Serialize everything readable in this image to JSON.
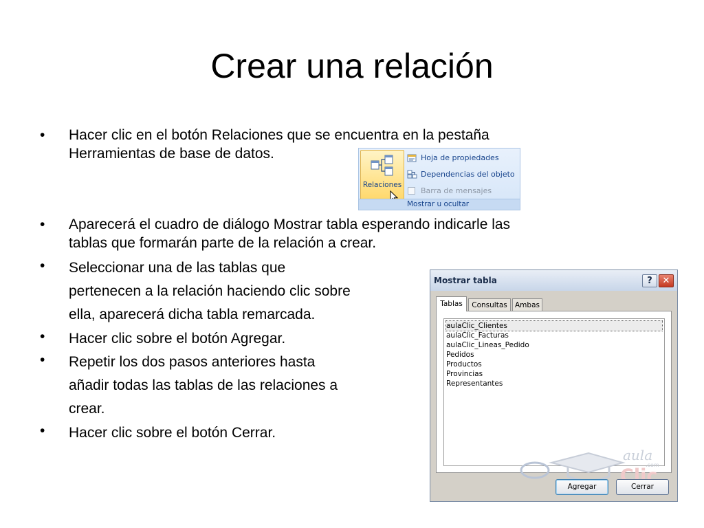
{
  "slide": {
    "title": "Crear una relación"
  },
  "bullets": [
    {
      "symbol": "•",
      "lines": [
        "Hacer clic en el botón Relaciones que se encuentra en la pestaña",
        "Herramientas de base de datos."
      ]
    },
    {
      "symbol": "•",
      "lines": [
        "Aparecerá el cuadro de diálogo Mostrar tabla esperando indicarle las",
        "tablas que formarán parte de la relación a crear."
      ]
    },
    {
      "symbol": "•",
      "lines": [
        "Seleccionar una de las tablas que",
        "pertenecen a la relación haciendo clic sobre",
        "ella, aparecerá dicha tabla remarcada."
      ]
    },
    {
      "symbol": "•",
      "lines": [
        "Hacer clic sobre el botón Agregar."
      ]
    },
    {
      "symbol": "•",
      "lines": [
        "Repetir los dos pasos anteriores hasta",
        "añadir todas las tablas de las relaciones a",
        "crear."
      ]
    },
    {
      "symbol": "•",
      "lines": [
        "Hacer clic sobre el botón Cerrar."
      ]
    }
  ],
  "ribbon": {
    "relaciones_label": "Relaciones",
    "items": [
      "Hoja de propiedades",
      "Dependencias del objeto",
      "Barra de mensajes"
    ],
    "group_label": "Mostrar u ocultar"
  },
  "dialog": {
    "title": "Mostrar tabla",
    "help_label": "?",
    "close_label": "✕",
    "tabs": [
      "Tablas",
      "Consultas",
      "Ambas"
    ],
    "tables": [
      "aulaClic_Clientes",
      "aulaClic_Facturas",
      "aulaClic_Lineas_Pedido",
      "Pedidos",
      "Productos",
      "Provincias",
      "Representantes"
    ],
    "agregar_label": "Agregar",
    "cerrar_label": "Cerrar"
  },
  "watermark": {
    "line1": "aula",
    "line2": "Clic",
    "small": ".com"
  }
}
